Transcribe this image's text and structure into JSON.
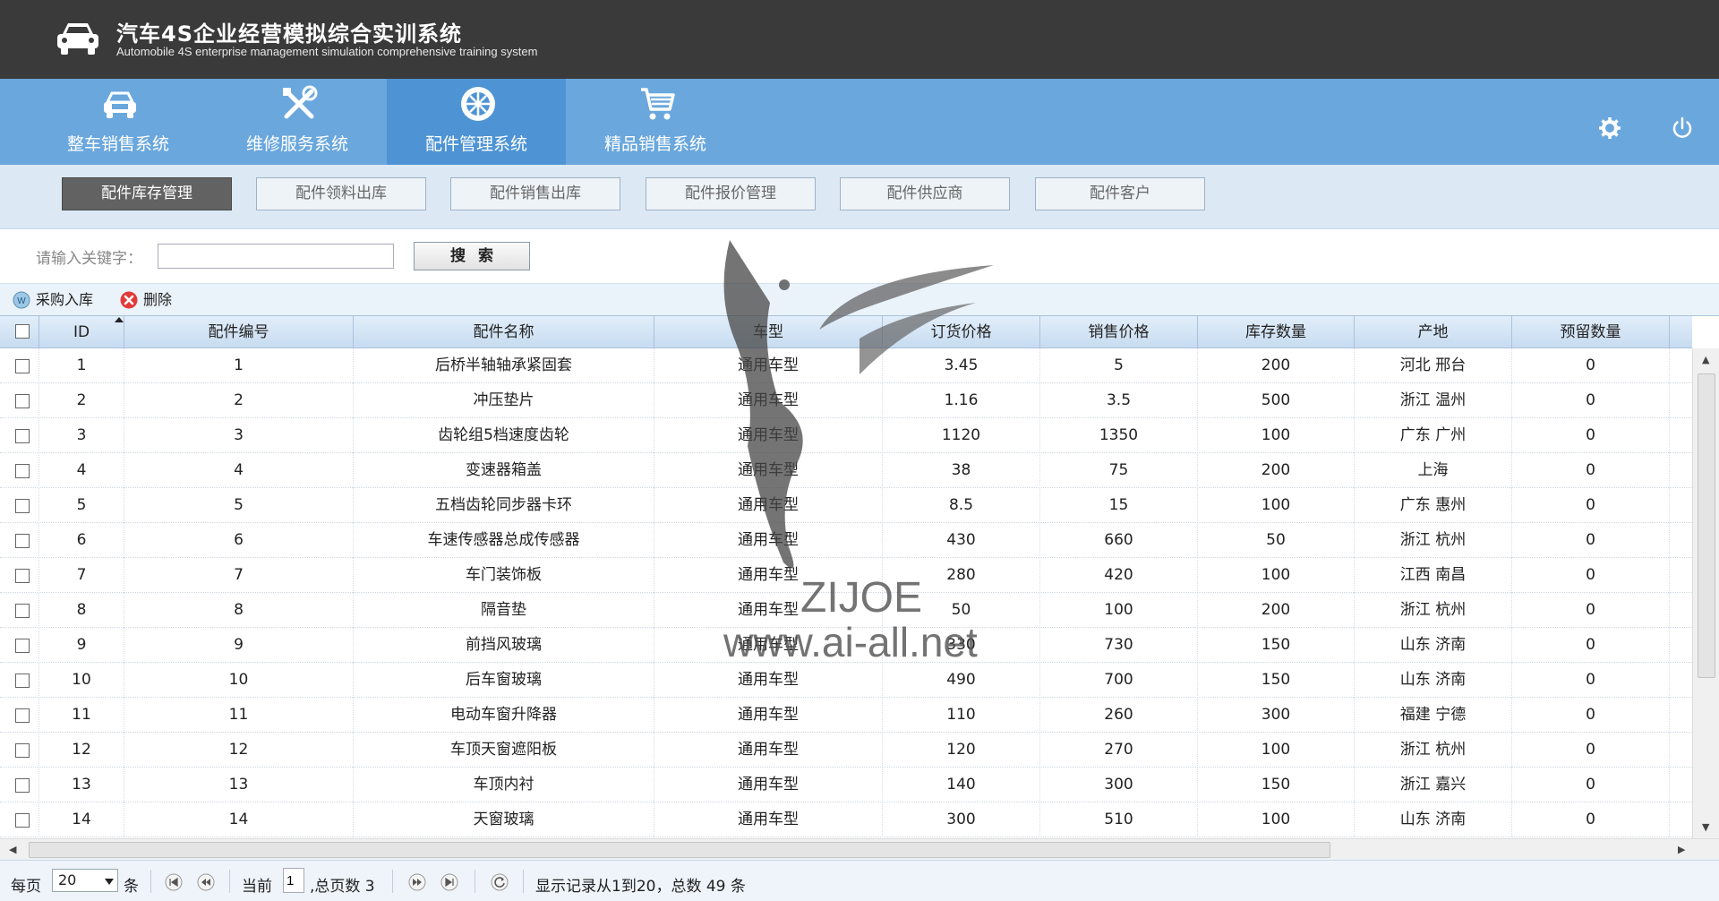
{
  "header": {
    "title": "汽车4S企业经营模拟综合实训系统",
    "subtitle": "Automobile 4S enterprise management simulation comprehensive training system"
  },
  "modules": [
    {
      "label": "整车销售系统",
      "icon": "car-icon"
    },
    {
      "label": "维修服务系统",
      "icon": "tools-icon"
    },
    {
      "label": "配件管理系统",
      "icon": "wheel-icon",
      "active": true
    },
    {
      "label": "精品销售系统",
      "icon": "cart-icon"
    }
  ],
  "subnav": [
    {
      "label": "配件库存管理",
      "active": true
    },
    {
      "label": "配件领料出库"
    },
    {
      "label": "配件销售出库"
    },
    {
      "label": "配件报价管理"
    },
    {
      "label": "配件供应商"
    },
    {
      "label": "配件客户"
    }
  ],
  "search": {
    "label": "请输入关键字：",
    "value": "",
    "button": "搜索"
  },
  "toolbar": {
    "purchase": "采购入库",
    "delete": "删除"
  },
  "table": {
    "columns": [
      "ID",
      "配件编号",
      "配件名称",
      "车型",
      "订货价格",
      "销售价格",
      "库存数量",
      "产地",
      "预留数量"
    ],
    "rows": [
      [
        "1",
        "1",
        "后桥半轴轴承紧固套",
        "通用车型",
        "3.45",
        "5",
        "200",
        "河北 邢台",
        "0"
      ],
      [
        "2",
        "2",
        "冲压垫片",
        "通用车型",
        "1.16",
        "3.5",
        "500",
        "浙江 温州",
        "0"
      ],
      [
        "3",
        "3",
        "齿轮组5档速度齿轮",
        "通用车型",
        "1120",
        "1350",
        "100",
        "广东 广州",
        "0"
      ],
      [
        "4",
        "4",
        "变速器箱盖",
        "通用车型",
        "38",
        "75",
        "200",
        "上海",
        "0"
      ],
      [
        "5",
        "5",
        "五档齿轮同步器卡环",
        "通用车型",
        "8.5",
        "15",
        "100",
        "广东 惠州",
        "0"
      ],
      [
        "6",
        "6",
        "车速传感器总成传感器",
        "通用车型",
        "430",
        "660",
        "50",
        "浙江 杭州",
        "0"
      ],
      [
        "7",
        "7",
        "车门装饰板",
        "通用车型",
        "280",
        "420",
        "100",
        "江西 南昌",
        "0"
      ],
      [
        "8",
        "8",
        "隔音垫",
        "通用车型",
        "50",
        "100",
        "200",
        "浙江 杭州",
        "0"
      ],
      [
        "9",
        "9",
        "前挡风玻璃",
        "通用车型",
        "330",
        "730",
        "150",
        "山东 济南",
        "0"
      ],
      [
        "10",
        "10",
        "后车窗玻璃",
        "通用车型",
        "490",
        "700",
        "150",
        "山东 济南",
        "0"
      ],
      [
        "11",
        "11",
        "电动车窗升降器",
        "通用车型",
        "110",
        "260",
        "300",
        "福建 宁德",
        "0"
      ],
      [
        "12",
        "12",
        "车顶天窗遮阳板",
        "通用车型",
        "120",
        "270",
        "100",
        "浙江 杭州",
        "0"
      ],
      [
        "13",
        "13",
        "车顶内衬",
        "通用车型",
        "140",
        "300",
        "150",
        "浙江 嘉兴",
        "0"
      ],
      [
        "14",
        "14",
        "天窗玻璃",
        "通用车型",
        "300",
        "510",
        "100",
        "山东 济南",
        "0"
      ]
    ]
  },
  "pager": {
    "per_page_label": "每页",
    "per_page_value": "20",
    "per_page_unit": "条",
    "current_label": "当前",
    "current_value": "1",
    "total_pages": ",总页数 3",
    "summary": "显示记录从1到20，总数 49 条"
  },
  "watermark": {
    "brand": "ZIJOE",
    "url": "www.ai-all.net"
  },
  "colors": {
    "header_bg": "#3a3a3a",
    "nav_bg": "#6aa7dd",
    "nav_active": "#4e94d4",
    "subnav_active": "#626262"
  }
}
